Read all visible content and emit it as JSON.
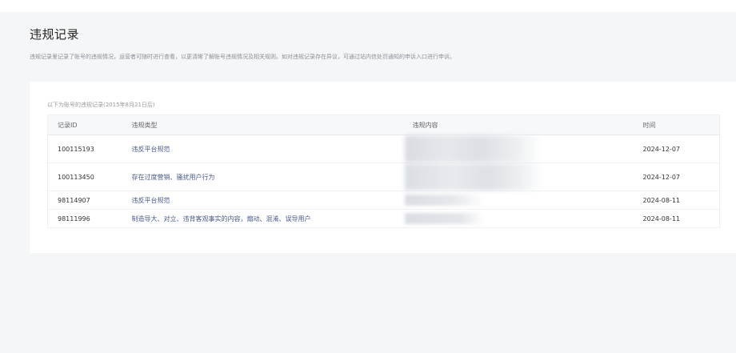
{
  "page": {
    "title": "违规记录",
    "description": "违规记录里记录了账号的违规情况，运营者可随时进行查看，以更清晰了解账号违规情况及相关规则。如对违规记录存在异议，可通过站内信处罚通知的申诉入口进行申诉。"
  },
  "records": {
    "caption": "以下为账号的违规记录(2015年8月21日后)",
    "headers": {
      "id": "记录ID",
      "type": "违规类型",
      "content": "违规内容",
      "time": "时间"
    },
    "rows": [
      {
        "id": "100115193",
        "type": "违反平台规范",
        "time": "2024-12-07"
      },
      {
        "id": "100113450",
        "type": "存在过度营销、骚扰用户行为",
        "time": "2024-12-07"
      },
      {
        "id": "98114907",
        "type": "违反平台规范",
        "time": "2024-08-11"
      },
      {
        "id": "98111996",
        "type": "制造导大、对立、违背客观事实的内容，煽动、混淆、误导用户",
        "time": "2024-08-11"
      }
    ]
  }
}
